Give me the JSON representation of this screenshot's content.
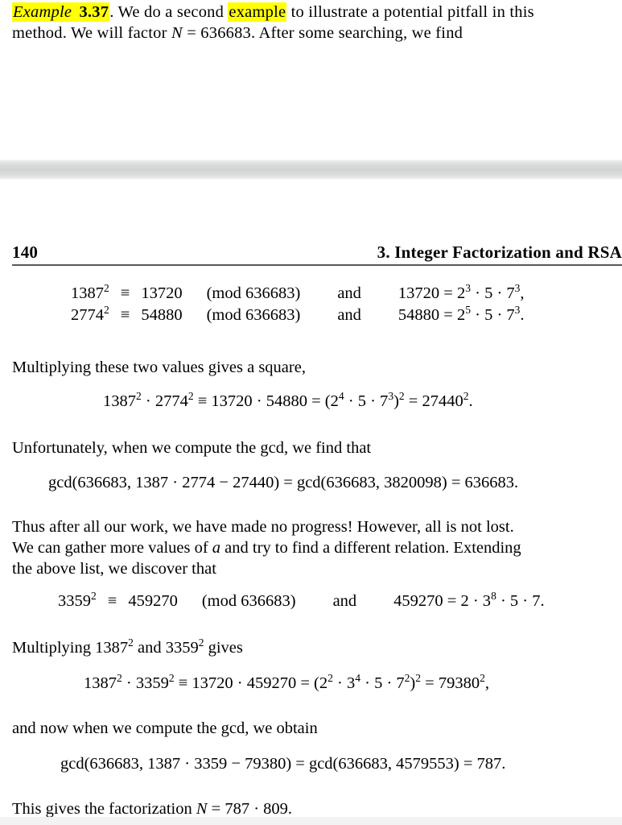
{
  "document": {
    "type": "textbook-page",
    "highlight_color": "#ffff00",
    "page_background": "#ffffff"
  },
  "fragment_top": {
    "line1": {
      "highlight_1_italic": "Example",
      "highlight_1_bold": "3.37",
      "text_after_1": ". We do a second ",
      "highlight_2": "example",
      "text_after_2": " to illustrate a potential pitfall in this"
    },
    "line2": {
      "part1": "method. We will factor ",
      "var_N": "N",
      "part2": " = 636683. After some searching, we find"
    }
  },
  "page_header": {
    "folio": "140",
    "running_title": "3. Integer Factorization and RSA"
  },
  "display_1": {
    "row1": {
      "base": "1387",
      "exp": "2",
      "rel": "≡",
      "value": "13720",
      "mod": "(mod 636683)",
      "conj": "and",
      "rhs_lhs": "13720 = 2",
      "rhs_exp1": "3",
      "rhs_mid": " · 5 · 7",
      "rhs_exp2": "3",
      "rhs_end": ","
    },
    "row2": {
      "base": "2774",
      "exp": "2",
      "rel": "≡",
      "value": "54880",
      "mod": "(mod 636683)",
      "conj": "and",
      "rhs_lhs": "54880 = 2",
      "rhs_exp1": "5",
      "rhs_mid": " · 5 · 7",
      "rhs_exp2": "3",
      "rhs_end": "."
    }
  },
  "para_1": {
    "line1": "Multiplying these two values gives a square,"
  },
  "display_2": {
    "seg1": "1387",
    "exp1": "2",
    "seg2": " · 2774",
    "exp2": "2",
    "seg3": " ≡ 13720 · 54880 = (2",
    "exp3": "4",
    "seg4": " · 5 · 7",
    "exp4": "3",
    "seg5": ")",
    "exp5": "2",
    "seg6": " = 27440",
    "exp6": "2",
    "seg7": "."
  },
  "para_2": {
    "line1": "Unfortunately, when we compute the gcd, we find that"
  },
  "display_3": {
    "text": "gcd(636683, 1387 · 2774 − 27440) = gcd(636683, 3820098) = 636683."
  },
  "para_3": {
    "line1": "Thus after all our work, we have made no progress! However, all is not lost.",
    "line2_part1": "We can gather more values of ",
    "line2_var": "a",
    "line2_part2": " and try to find a different relation. Extending",
    "line3": "the above list, we discover that"
  },
  "display_4": {
    "base": "3359",
    "exp": "2",
    "rel": "≡",
    "value": "459270",
    "mod": "(mod 636683)",
    "conj": "and",
    "rhs_lhs": "459270 = 2 · 3",
    "rhs_exp1": "8",
    "rhs_end": " · 5 · 7."
  },
  "para_4": {
    "part1": "Multiplying 1387",
    "exp1": "2",
    "part2": " and 3359",
    "exp2": "2",
    "part3": " gives"
  },
  "display_5": {
    "seg1": "1387",
    "exp1": "2",
    "seg2": " · 3359",
    "exp2": "2",
    "seg3": " ≡ 13720 · 459270 = (2",
    "exp3": "2",
    "seg4": " · 3",
    "exp4": "4",
    "seg5": " · 5 · 7",
    "exp5": "2",
    "seg6": ")",
    "exp6": "2",
    "seg7": " = 79380",
    "exp7": "2",
    "seg8": ","
  },
  "para_5": {
    "line1": "and now when we compute the gcd, we obtain"
  },
  "display_6": {
    "text": "gcd(636683, 1387 · 3359 − 79380) = gcd(636683, 4579553) = 787."
  },
  "para_6": {
    "part1": "This gives the factorization ",
    "var_N": "N",
    "part2": " = 787 · 809."
  }
}
